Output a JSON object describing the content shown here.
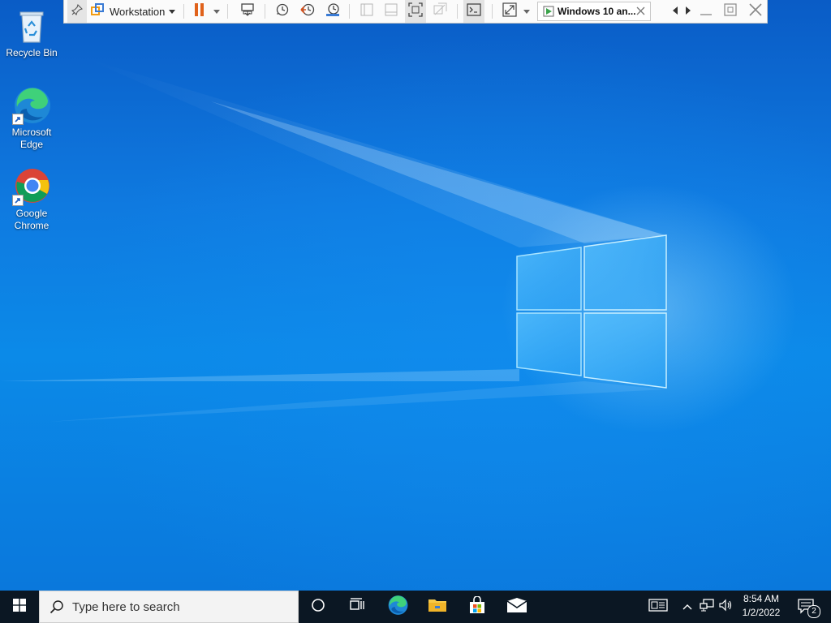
{
  "desktop": {
    "icons": [
      {
        "label": "Recycle Bin"
      },
      {
        "label": "Microsoft Edge"
      },
      {
        "label": "Google Chrome"
      }
    ]
  },
  "vmware_toolbar": {
    "workstation_menu_label": "Workstation",
    "vm_tab_title": "Windows 10 an...",
    "icons": [
      "pin-icon",
      "vmware-logo-icon",
      "chevron-down-icon",
      "pause-icon",
      "send-ctrl-alt-del-icon",
      "snapshot-take-icon",
      "snapshot-revert-icon",
      "snapshot-manager-icon",
      "library-view-icon",
      "thumbnail-view-icon",
      "fit-guest-icon",
      "unity-icon",
      "console-view-icon",
      "fullscreen-icon",
      "tab-prev-icon",
      "tab-next-icon",
      "minimize-icon",
      "restore-icon",
      "close-icon"
    ]
  },
  "taskbar": {
    "search_placeholder": "Type here to search",
    "time": "8:54 AM",
    "date": "1/2/2022",
    "notification_count": "2",
    "pinned": [
      "task-view",
      "edge",
      "file-explorer",
      "store",
      "mail"
    ]
  },
  "colors": {
    "desktop_blue": "#0f7ae0",
    "taskbar": "#0b1723",
    "pause_orange": "#e0621b"
  }
}
